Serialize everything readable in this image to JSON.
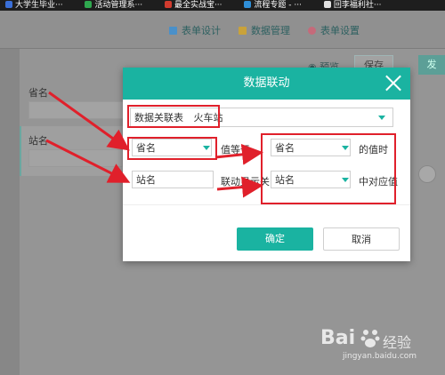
{
  "bookmarks": [
    {
      "label": "大学生毕业···",
      "icon": "bookmark-icon",
      "color": "#3a6fd8"
    },
    {
      "label": "活动管理系···",
      "icon": "bookmark-icon",
      "color": "#2fa84f"
    },
    {
      "label": "最全实战宝···",
      "icon": "bookmark-icon",
      "color": "#d13b2e"
    },
    {
      "label": "流程专题 - ···",
      "icon": "bookmark-icon",
      "color": "#2f8fd8"
    },
    {
      "label": "回李福利社···",
      "icon": "bookmark-icon",
      "color": "#e0e0e0"
    }
  ],
  "tabs": [
    {
      "label": "表单设计",
      "icon": "form-design-icon",
      "color": "#4a90c9"
    },
    {
      "label": "数据管理",
      "icon": "data-manage-icon",
      "color": "#c9a23a"
    },
    {
      "label": "表单设置",
      "icon": "gear-icon",
      "color": "#c56a7a"
    }
  ],
  "page": {
    "preview_label": "预览",
    "save_label": "保存",
    "publish_label": "发",
    "fields": [
      "省名",
      "站名"
    ]
  },
  "dialog": {
    "title": "数据联动",
    "table_label": "数据关联表",
    "table_value": "火车站",
    "row1": {
      "field": "省名",
      "condition": "值等于",
      "target": "省名",
      "suffix": "的值时"
    },
    "row2": {
      "field": "站名",
      "condition": "联动显示关",
      "target": "站名",
      "suffix": "中对应值"
    },
    "ok_label": "确定",
    "cancel_label": "取消"
  },
  "colors": {
    "accent": "#1ab3a1",
    "highlight": "#e0202b"
  },
  "watermark": {
    "brand": "Bai",
    "logo": "baidu-paw-icon",
    "sub": "经验",
    "url": "jingyan.baidu.com"
  }
}
